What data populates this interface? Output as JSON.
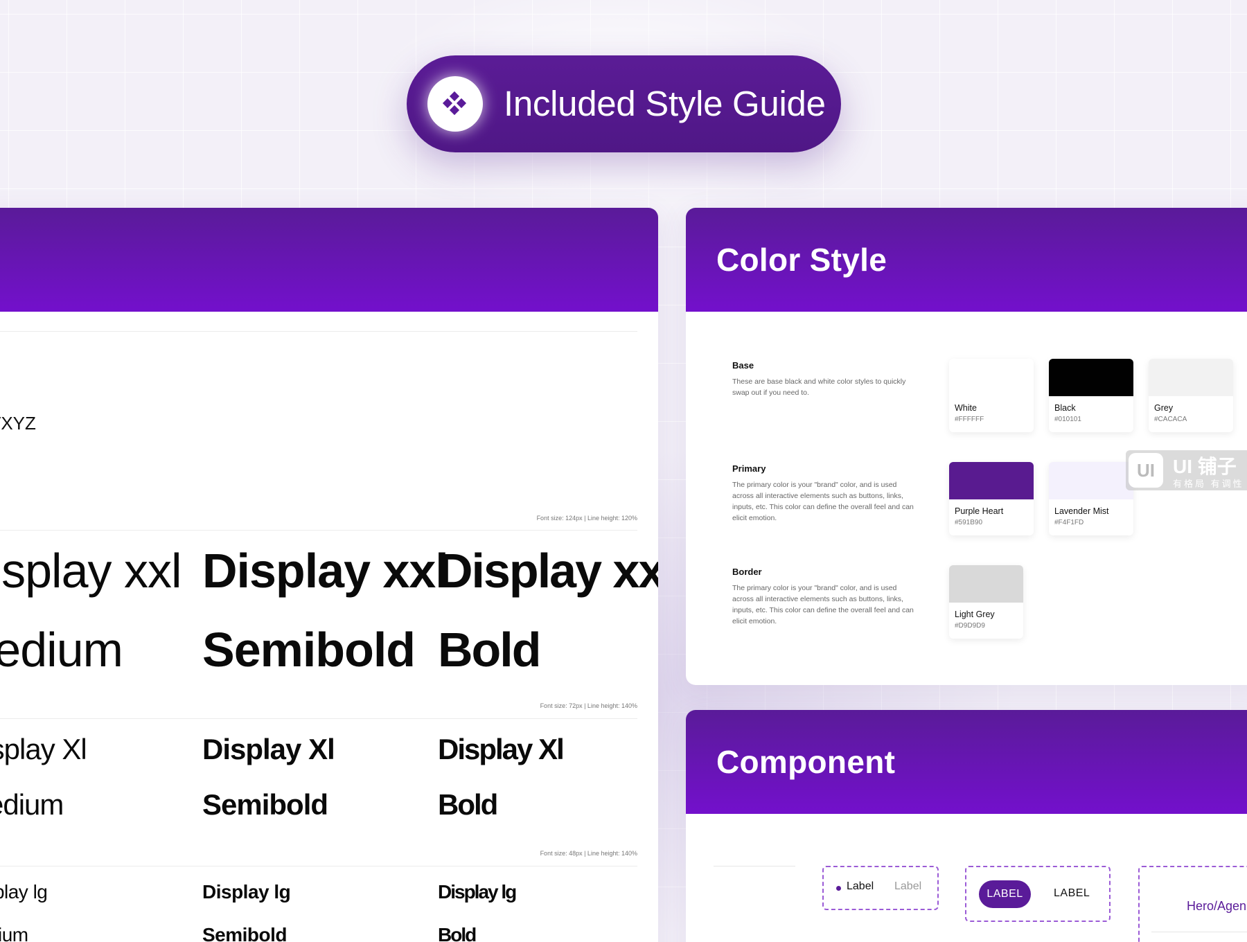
{
  "banner": {
    "title": "Included Style Guide",
    "icon": "diamond-grid-icon"
  },
  "typography": {
    "alphabet_fragment": "VXYZ",
    "sections": [
      {
        "meta": "Font size: 124px | Line height: 120%",
        "samples": [
          {
            "name": "Display xxl",
            "weight": "Medium"
          },
          {
            "name": "Display xxl",
            "weight": "Semibold"
          },
          {
            "name": "Display xxl",
            "weight": "Bold"
          }
        ]
      },
      {
        "meta": "Font size: 72px | Line height: 140%",
        "samples": [
          {
            "name": "Display Xl",
            "weight": "Medium"
          },
          {
            "name": "Display Xl",
            "weight": "Semibold"
          },
          {
            "name": "Display Xl",
            "weight": "Bold"
          }
        ]
      },
      {
        "meta": "Font size: 48px | Line height: 140%",
        "samples": [
          {
            "name": "Display lg",
            "weight": "Medium"
          },
          {
            "name": "Display lg",
            "weight": "Semibold"
          },
          {
            "name": "Display lg",
            "weight": "Bold"
          }
        ]
      }
    ]
  },
  "color_style": {
    "title": "Color Style",
    "groups": [
      {
        "title": "Base",
        "description": "These are base black and white color styles to quickly swap out if you need to.",
        "swatches": [
          {
            "name": "White",
            "hex": "#FFFFFF",
            "color": "#FFFFFF"
          },
          {
            "name": "Black",
            "hex": "#010101",
            "color": "#010101"
          },
          {
            "name": "Grey",
            "hex": "#CACACA",
            "color": "#F2F2F2"
          }
        ]
      },
      {
        "title": "Primary",
        "description": "The primary color is your \"brand\" color, and is used across all interactive elements such as buttons, links, inputs, etc. This color can define the overall feel and can elicit emotion.",
        "swatches": [
          {
            "name": "Purple Heart",
            "hex": "#591B90",
            "color": "#591B90"
          },
          {
            "name": "Lavender Mist",
            "hex": "#F4F1FD",
            "color": "#F4F1FD"
          }
        ]
      },
      {
        "title": "Border",
        "description": "The primary color is your \"brand\" color, and is used across all interactive elements such as buttons, links, inputs, etc. This color can define the overall feel and can elicit emotion.",
        "swatches": [
          {
            "name": "Light Grey",
            "hex": "#D9D9D9",
            "color": "#D9D9D9"
          }
        ]
      }
    ]
  },
  "watermark": {
    "logo": "UI",
    "title": "UI 铺子",
    "subtitle": "有格局 有调性"
  },
  "component": {
    "title": "Component",
    "tab_active": "Label",
    "tab_inactive": "Label",
    "pill_active": "LABEL",
    "pill_inactive": "LABEL",
    "hero_text": "Hero/Agen"
  },
  "colors": {
    "brand": "#591B90",
    "brand_light": "#7310CC",
    "accent_dash": "#9B5BD6"
  }
}
